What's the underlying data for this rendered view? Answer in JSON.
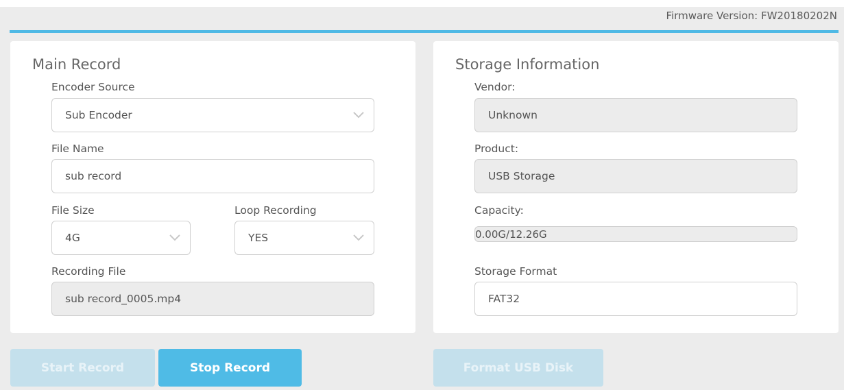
{
  "header": {
    "firmware": "Firmware Version: FW20180202N"
  },
  "main_record": {
    "title": "Main Record",
    "encoder_source": {
      "label": "Encoder Source",
      "value": "Sub Encoder"
    },
    "file_name": {
      "label": "File Name",
      "value": "sub record"
    },
    "file_size": {
      "label": "File Size",
      "value": "4G"
    },
    "loop_recording": {
      "label": "Loop Recording",
      "value": "YES"
    },
    "recording_file": {
      "label": "Recording File",
      "value": "sub record_0005.mp4"
    }
  },
  "storage": {
    "title": "Storage Information",
    "vendor": {
      "label": "Vendor:",
      "value": "Unknown"
    },
    "product": {
      "label": "Product:",
      "value": "USB Storage"
    },
    "capacity": {
      "label": "Capacity:",
      "value": "0.00G/12.26G",
      "used_fraction": 0
    },
    "format": {
      "label": "Storage Format",
      "value": "FAT32"
    }
  },
  "buttons": {
    "start_record": "Start Record",
    "stop_record": "Stop Record",
    "format_usb": "Format USB Disk"
  },
  "colors": {
    "accent": "#4fbbe6",
    "disabled": "#c4e0ec"
  }
}
